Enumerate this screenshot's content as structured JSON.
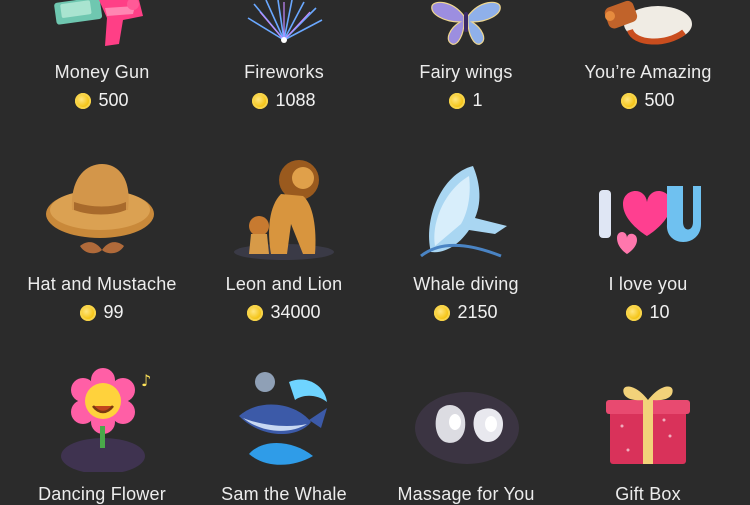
{
  "currency_icon": "coin-icon",
  "coin_color": "#f5c518",
  "background": "#2b2b2b",
  "gifts": [
    {
      "name": "Money Gun",
      "price": "500",
      "icon": "money-gun-icon"
    },
    {
      "name": "Fireworks",
      "price": "1088",
      "icon": "fireworks-icon"
    },
    {
      "name": "Fairy wings",
      "price": "1",
      "icon": "fairy-wings-icon"
    },
    {
      "name": "You’re Amazing",
      "price": "500",
      "icon": "youre-amazing-icon"
    },
    {
      "name": "Hat and Mustache",
      "price": "99",
      "icon": "hat-mustache-icon"
    },
    {
      "name": "Leon and Lion",
      "price": "34000",
      "icon": "lion-icon"
    },
    {
      "name": "Whale diving",
      "price": "2150",
      "icon": "whale-icon"
    },
    {
      "name": "I love you",
      "price": "10",
      "icon": "heart-u-icon"
    },
    {
      "name": "Dancing Flower",
      "price": "",
      "icon": "dancing-flower-icon"
    },
    {
      "name": "Sam the Whale",
      "price": "",
      "icon": "sam-whale-icon"
    },
    {
      "name": "Massage for You",
      "price": "",
      "icon": "massage-icon"
    },
    {
      "name": "Gift Box",
      "price": "",
      "icon": "gift-box-icon"
    }
  ]
}
